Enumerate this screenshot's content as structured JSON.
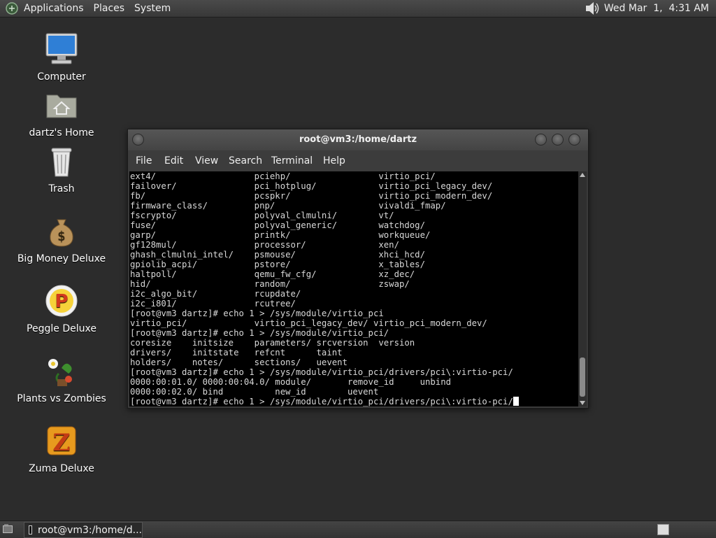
{
  "top_panel": {
    "menus": [
      "Applications",
      "Places",
      "System"
    ],
    "clock": "Wed Mar  1,  4:31 AM"
  },
  "desktop": {
    "icons": [
      {
        "label": "Computer",
        "icon": "computer-icon"
      },
      {
        "label": "dartz's Home",
        "icon": "home-folder-icon"
      },
      {
        "label": "Trash",
        "icon": "trash-icon"
      },
      {
        "label": "Big Money Deluxe",
        "icon": "money-bag-icon"
      },
      {
        "label": "Peggle Deluxe",
        "icon": "peggle-icon"
      },
      {
        "label": "Plants vs Zombies",
        "icon": "plants-icon"
      },
      {
        "label": "Zuma Deluxe",
        "icon": "zuma-icon"
      }
    ]
  },
  "terminal": {
    "title": "root@vm3:/home/dartz",
    "menu": [
      "File",
      "Edit",
      "View",
      "Search",
      "Terminal",
      "Help"
    ],
    "lines": [
      "ext4/                   pciehp/                 virtio_pci/",
      "failover/               pci_hotplug/            virtio_pci_legacy_dev/",
      "fb/                     pcspkr/                 virtio_pci_modern_dev/",
      "firmware_class/         pnp/                    vivaldi_fmap/",
      "fscrypto/               polyval_clmulni/        vt/",
      "fuse/                   polyval_generic/        watchdog/",
      "garp/                   printk/                 workqueue/",
      "gf128mul/               processor/              xen/",
      "ghash_clmulni_intel/    psmouse/                xhci_hcd/",
      "gpiolib_acpi/           pstore/                 x_tables/",
      "haltpoll/               qemu_fw_cfg/            xz_dec/",
      "hid/                    random/                 zswap/",
      "i2c_algo_bit/           rcupdate/",
      "i2c_i801/               rcutree/",
      "[root@vm3 dartz]# echo 1 > /sys/module/virtio_pci",
      "virtio_pci/             virtio_pci_legacy_dev/ virtio_pci_modern_dev/",
      "[root@vm3 dartz]# echo 1 > /sys/module/virtio_pci/",
      "coresize    initsize    parameters/ srcversion  version",
      "drivers/    initstate   refcnt      taint",
      "holders/    notes/      sections/   uevent",
      "[root@vm3 dartz]# echo 1 > /sys/module/virtio_pci/drivers/pci\\:virtio-pci/",
      "0000:00:01.0/ 0000:00:04.0/ module/       remove_id     unbind",
      "0000:00:02.0/ bind          new_id        uevent"
    ],
    "prompt_line": "[root@vm3 dartz]# echo 1 > /sys/module/virtio_pci/drivers/pci\\:virtio-pci/"
  },
  "bottom_panel": {
    "task_label": "root@vm3:/home/d..."
  }
}
